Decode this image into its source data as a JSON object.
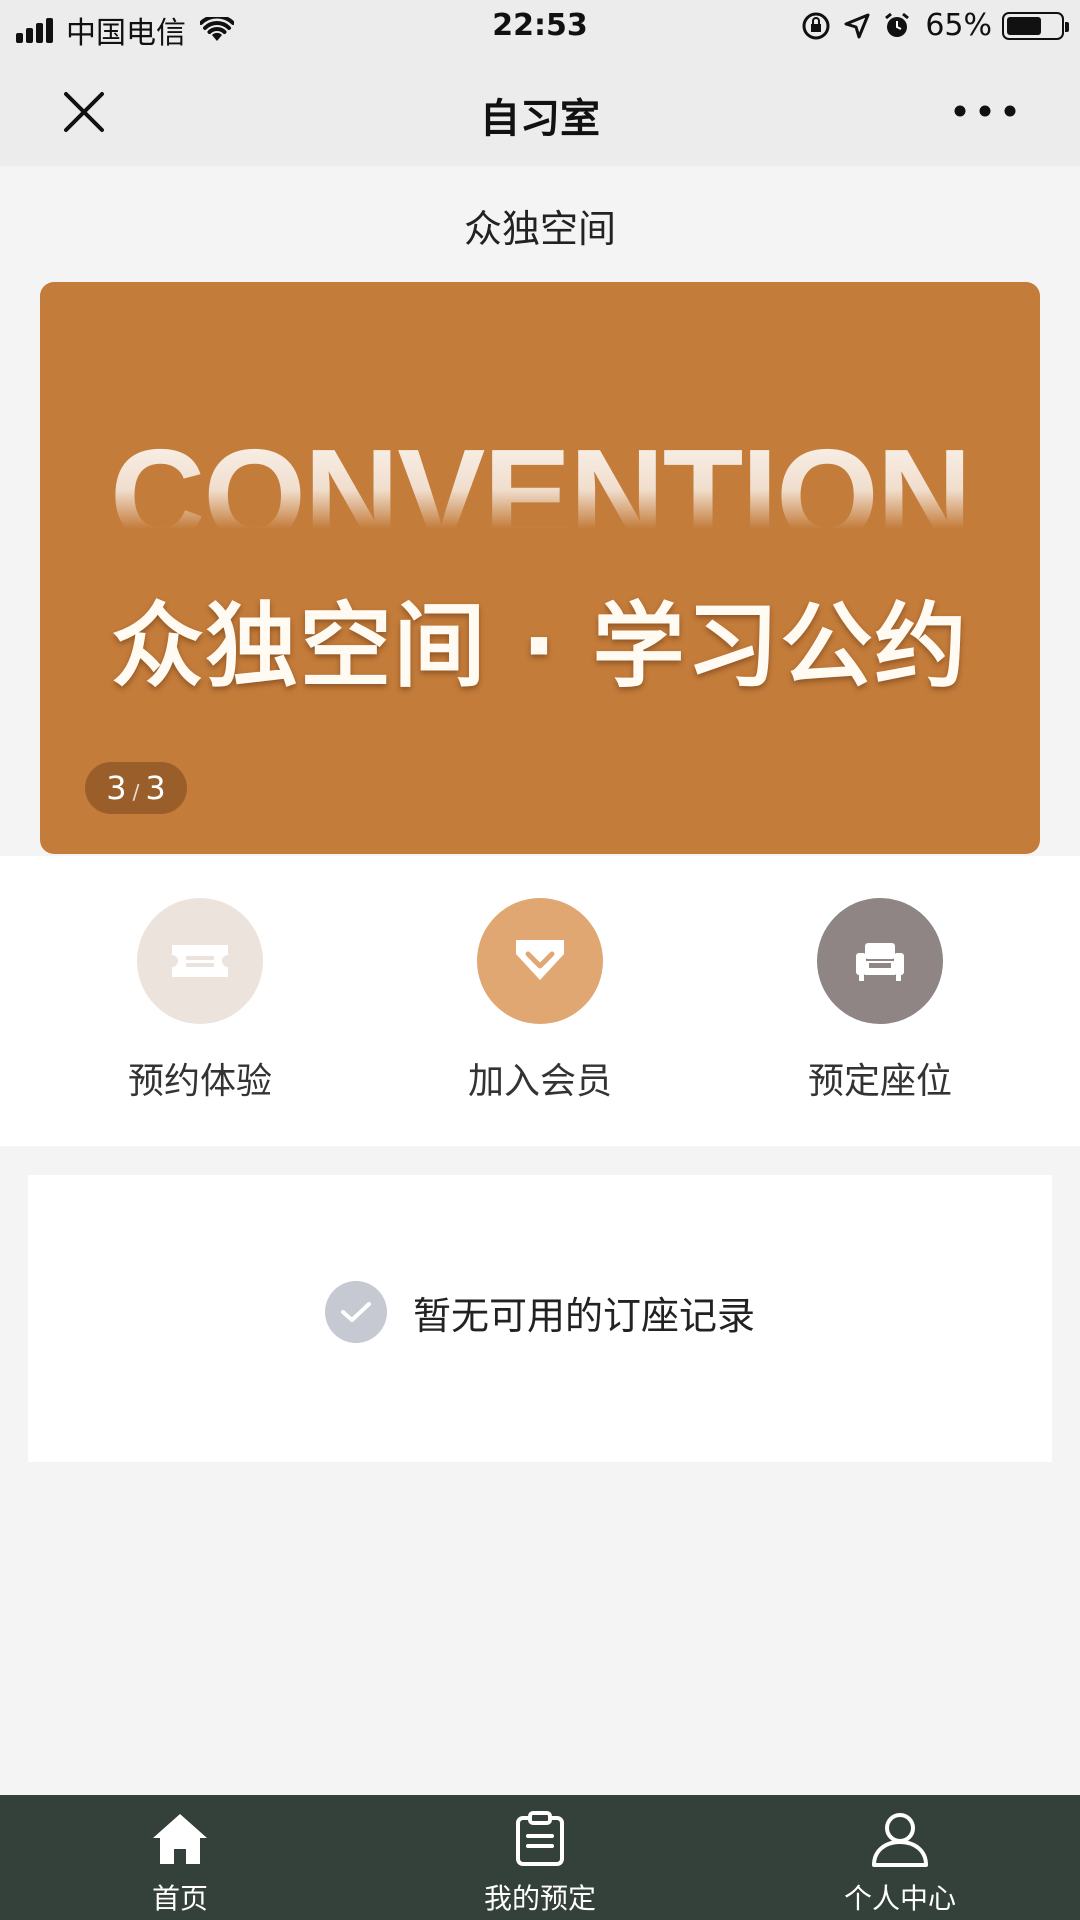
{
  "status_bar": {
    "carrier": "中国电信",
    "time": "22:53",
    "battery_percent": "65%",
    "battery_level": 0.65,
    "icons": [
      "signal-icon",
      "wifi-icon",
      "orientation-lock-icon",
      "location-icon",
      "alarm-icon",
      "battery-icon"
    ]
  },
  "nav": {
    "title": "自习室",
    "close_icon": "close-icon",
    "more_icon": "more-icon"
  },
  "space_name": "众独空间",
  "banner": {
    "bg_text": "CONVENTION",
    "title": "众独空间 · 学习公约",
    "pager_current": "3",
    "pager_total": "3",
    "color": "#c47c3a"
  },
  "quick_actions": [
    {
      "label": "预约体验",
      "icon": "ticket-icon",
      "color": "#ece4dc"
    },
    {
      "label": "加入会员",
      "icon": "diamond-icon",
      "color": "#e0a772"
    },
    {
      "label": "预定座位",
      "icon": "sofa-icon",
      "color": "#8f8584"
    }
  ],
  "records": {
    "empty_text": "暂无可用的订座记录",
    "icon": "check-circle-icon"
  },
  "tab_bar": {
    "color": "#34403a",
    "tabs": [
      {
        "label": "首页",
        "icon": "home-icon",
        "active": true
      },
      {
        "label": "我的预定",
        "icon": "clipboard-icon",
        "active": false
      },
      {
        "label": "个人中心",
        "icon": "user-icon",
        "active": false
      }
    ]
  }
}
